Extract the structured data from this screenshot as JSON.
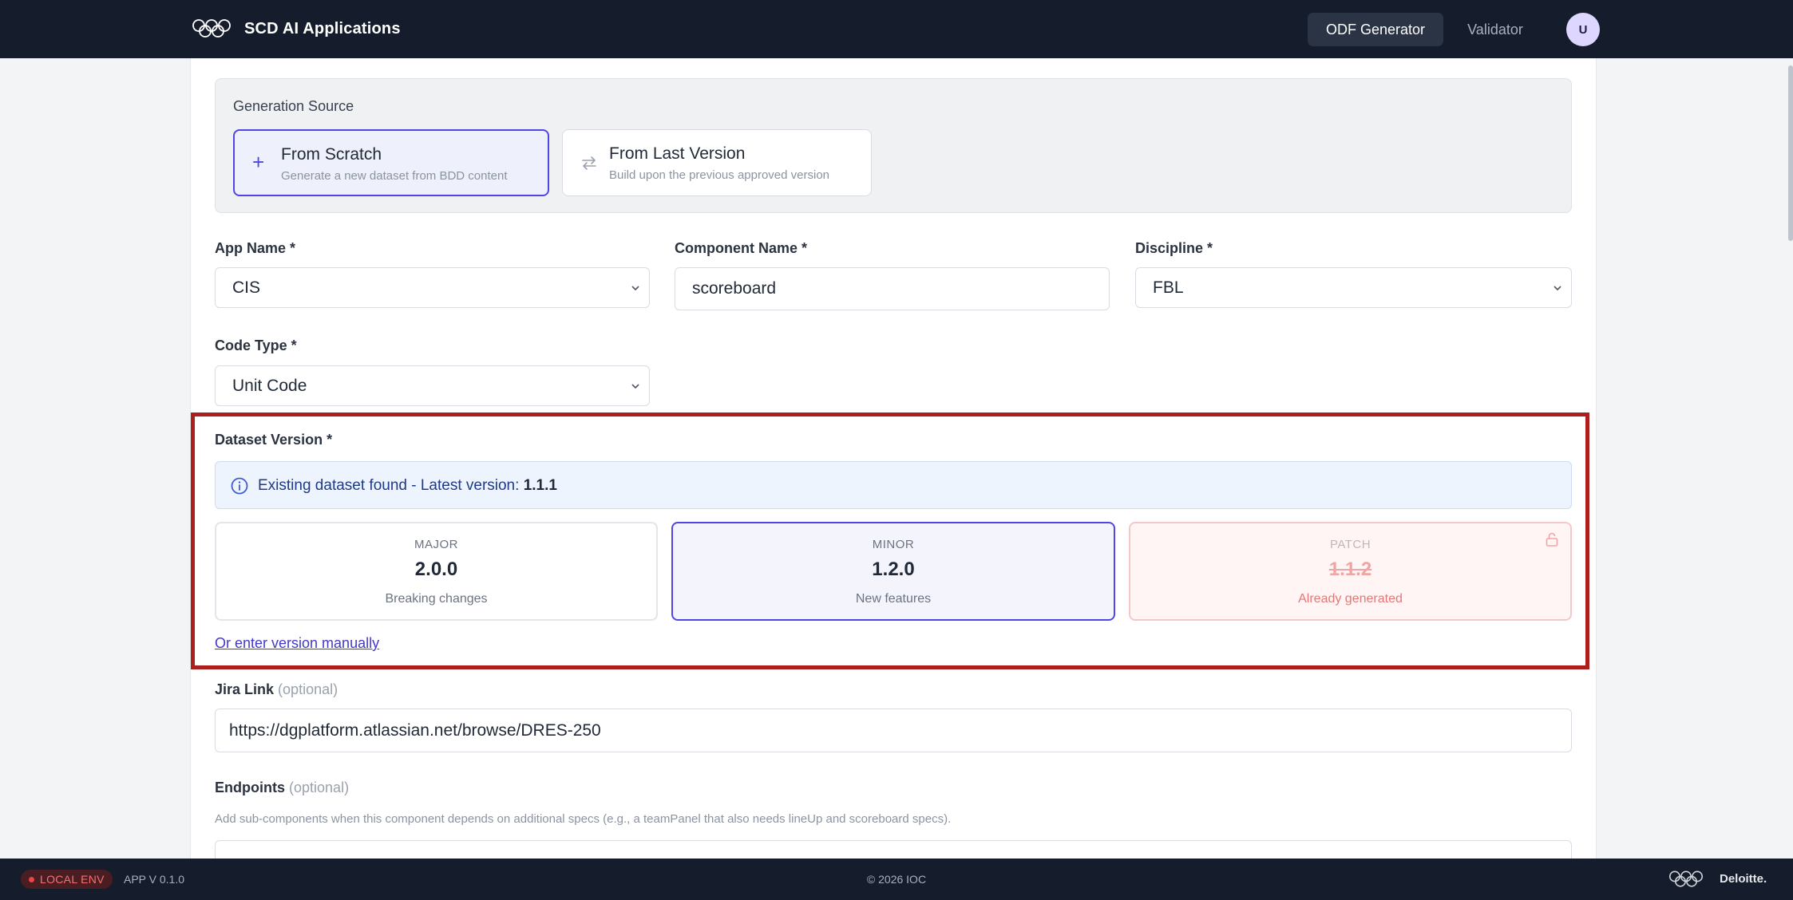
{
  "header": {
    "logo_icon": "olympic-rings-icon",
    "title": "SCD AI Applications",
    "nav": [
      {
        "label": "ODF Generator",
        "active": true
      },
      {
        "label": "Validator",
        "active": false
      }
    ],
    "avatar_initial": "U"
  },
  "generation_source": {
    "label": "Generation Source",
    "options": [
      {
        "icon": "plus-icon",
        "title": "From Scratch",
        "subtitle": "Generate a new dataset from BDD content",
        "selected": true
      },
      {
        "icon": "swap-arrows-icon",
        "title": "From Last Version",
        "subtitle": "Build upon the previous approved version",
        "selected": false
      }
    ]
  },
  "form": {
    "app_name": {
      "label": "App Name *",
      "value": "CIS"
    },
    "component_name": {
      "label": "Component Name *",
      "value": "scoreboard"
    },
    "discipline": {
      "label": "Discipline *",
      "value": "FBL"
    },
    "code_type": {
      "label": "Code Type *",
      "value": "Unit Code"
    }
  },
  "dataset_version": {
    "label": "Dataset Version *",
    "info_prefix": "Existing dataset found - Latest version: ",
    "latest_version": "1.1.1",
    "options": [
      {
        "kind": "MAJOR",
        "version": "2.0.0",
        "description": "Breaking changes",
        "state": "available"
      },
      {
        "kind": "MINOR",
        "version": "1.2.0",
        "description": "New features",
        "state": "selected"
      },
      {
        "kind": "PATCH",
        "version": "1.1.2",
        "description": "Already generated",
        "state": "locked"
      }
    ],
    "manual_link": "Or enter version manually",
    "highlight_color": "#ab1f1f"
  },
  "jira": {
    "label": "Jira Link",
    "optional": "(optional)",
    "value": "https://dgplatform.atlassian.net/browse/DRES-250"
  },
  "endpoints": {
    "label": "Endpoints",
    "optional": "(optional)",
    "help": "Add sub-components when this component depends on additional specs (e.g., a teamPanel that also needs lineUp and scoreboard specs)."
  },
  "footer": {
    "env_badge": "LOCAL ENV",
    "app_version": "APP V 0.1.0",
    "copyright": "© 2026 IOC",
    "partner": "Deloitte."
  },
  "colors": {
    "accent": "#4f46e5",
    "header_bg": "#151c2b",
    "locked": "#e57777"
  }
}
